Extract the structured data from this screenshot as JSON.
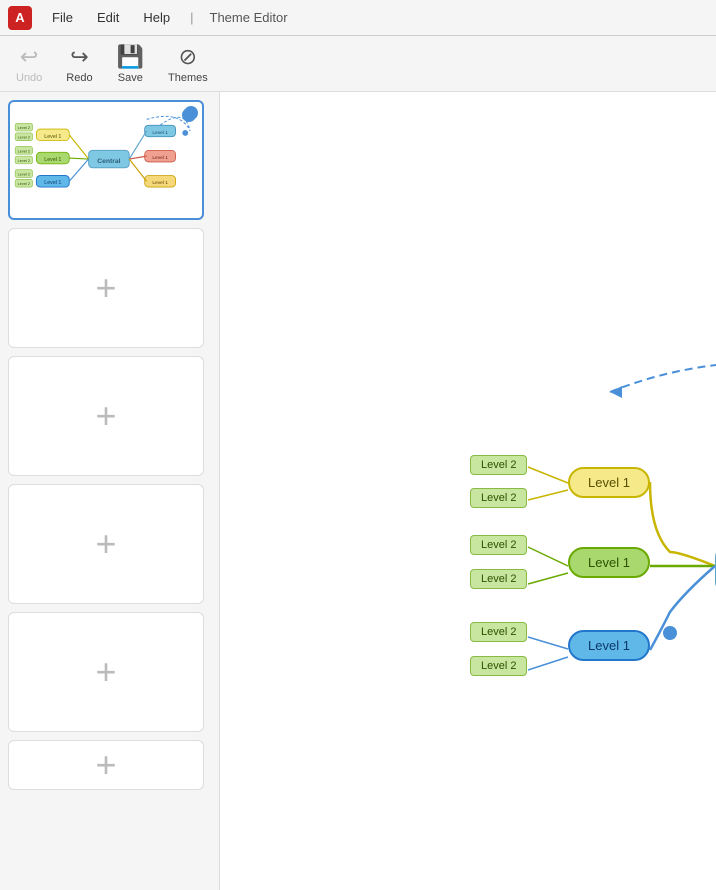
{
  "menubar": {
    "app_icon": "A",
    "file_label": "File",
    "edit_label": "Edit",
    "help_label": "Help",
    "separator": "|",
    "title": "Theme Editor"
  },
  "toolbar": {
    "undo_label": "Undo",
    "redo_label": "Redo",
    "save_label": "Save",
    "themes_label": "Themes"
  },
  "mindmap": {
    "central_label": "Central",
    "level1_nodes": [
      {
        "label": "Level 1",
        "type": "yellow"
      },
      {
        "label": "Level 1",
        "type": "green"
      },
      {
        "label": "Level 1",
        "type": "blue"
      }
    ],
    "level2_nodes": [
      "Level 2",
      "Level 2",
      "Level 2",
      "Level 2",
      "Level 2",
      "Level 2"
    ],
    "right_nodes": [
      {
        "label": "Le..."
      },
      {
        "label": "L..."
      },
      {
        "label": "Le..."
      }
    ]
  },
  "sidebar": {
    "add_labels": [
      "+",
      "+",
      "+",
      "+"
    ]
  }
}
